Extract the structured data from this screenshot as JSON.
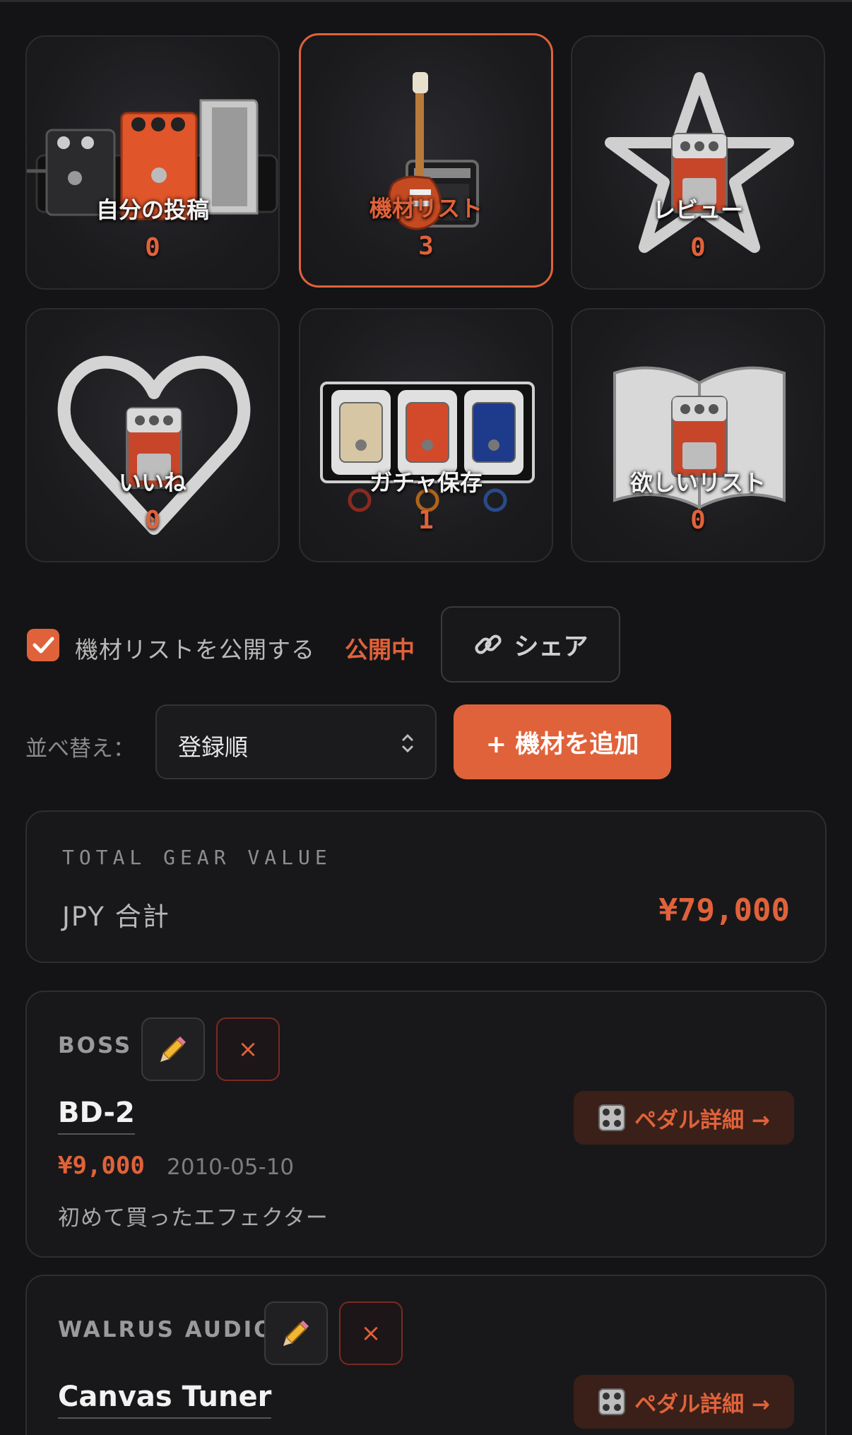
{
  "tiles": [
    {
      "label": "自分の投稿",
      "count": "0"
    },
    {
      "label": "機材リスト",
      "count": "3"
    },
    {
      "label": "レビュー",
      "count": "0"
    },
    {
      "label": "いいね",
      "count": "0"
    },
    {
      "label": "ガチャ保存",
      "count": "1"
    },
    {
      "label": "欲しいリスト",
      "count": "0"
    }
  ],
  "publish": {
    "label": "機材リストを公開する",
    "status": "公開中",
    "checked": true
  },
  "share": {
    "label": "シェア"
  },
  "sort": {
    "label": "並べ替え：",
    "value": "登録順"
  },
  "add_button": {
    "label": "+ 機材を追加"
  },
  "total": {
    "eyebrow": "TOTAL GEAR VALUE",
    "label": "JPY 合計",
    "value": "¥79,000"
  },
  "gear": [
    {
      "brand": "BOSS",
      "name": "BD-2",
      "price": "¥9,000",
      "date": "2010-05-10",
      "note": "初めて買ったエフェクター",
      "detail_label": "ペダル詳細 →",
      "delete_label": "×"
    },
    {
      "brand": "WALRUS AUDIO",
      "name": "Canvas Tuner",
      "price": "",
      "date": "",
      "note": "",
      "detail_label": "ペダル詳細 →",
      "delete_label": "×"
    }
  ],
  "colors": {
    "accent": "#e0623a",
    "background": "#141416",
    "card": "#18181a"
  }
}
